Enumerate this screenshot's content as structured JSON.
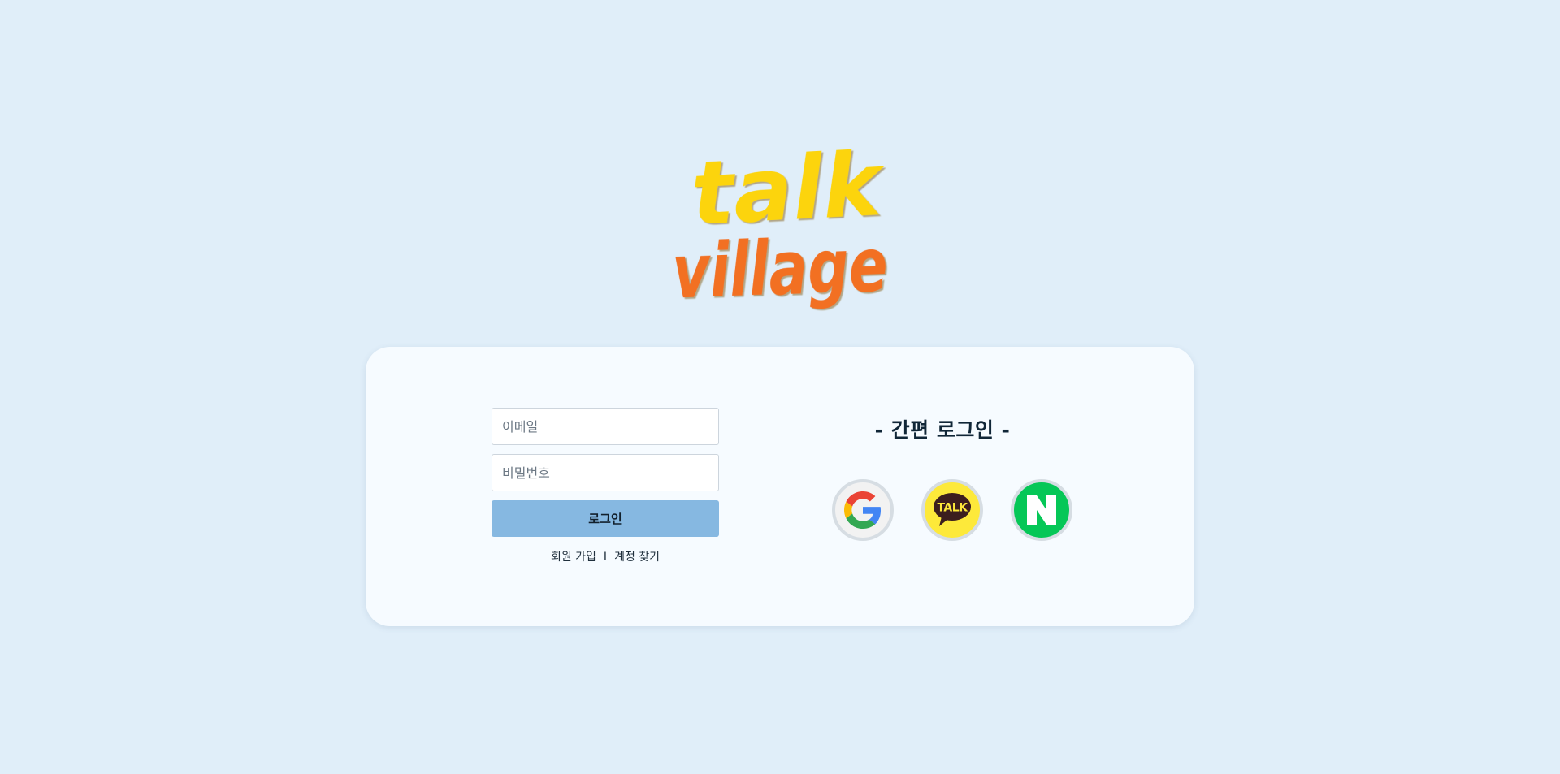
{
  "logo": {
    "line1": "talk",
    "line2": "village",
    "colors": {
      "line1": "#fcd410",
      "line2": "#f26f24"
    }
  },
  "login_form": {
    "email_placeholder": "이메일",
    "password_placeholder": "비밀번호",
    "login_button": "로그인",
    "signup_link": "회원 가입",
    "separator": "I",
    "find_account_link": "계정 찾기"
  },
  "easy_login": {
    "title": "- 간편 로그인 -",
    "providers": [
      {
        "name": "google",
        "icon": "google-logo-icon",
        "color": "#f2f2f2"
      },
      {
        "name": "kakao",
        "icon": "kakao-talk-icon",
        "label": "TALK",
        "color": "#fde93a"
      },
      {
        "name": "naver",
        "icon": "naver-logo-icon",
        "color": "#05c757"
      }
    ]
  },
  "colors": {
    "page_background": "#e0eef9",
    "card_background": "#f6fbff",
    "login_button": "#86b8e1"
  }
}
